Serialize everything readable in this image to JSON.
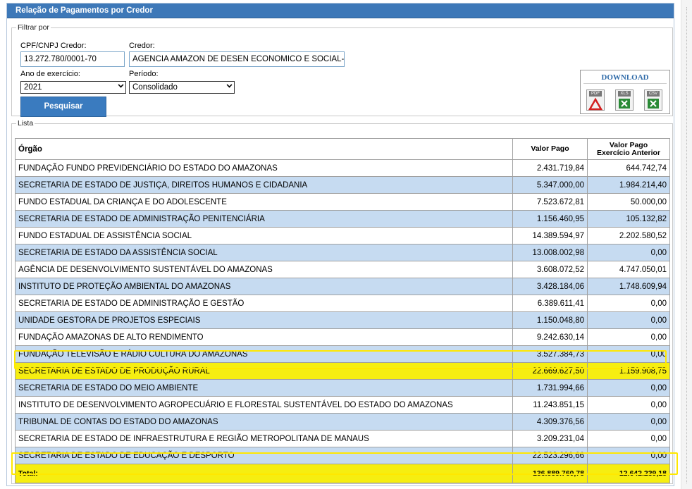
{
  "header": {
    "title": "Relação de Pagamentos por Credor"
  },
  "filter": {
    "legend": "Filtrar por",
    "cpf_label": "CPF/CNPJ Credor:",
    "cpf_value": "13.272.780/0001-70",
    "credor_label": "Credor:",
    "credor_value": "AGENCIA AMAZON DE DESEN ECONOMICO E SOCIAL- A",
    "ano_label": "Ano de exercício:",
    "ano_value": "2021",
    "periodo_label": "Período:",
    "periodo_value": "Consolidado",
    "search_label": "Pesquisar"
  },
  "download": {
    "title": "DOWNLOAD",
    "items": [
      {
        "label": "PDF",
        "icon": "pdf-icon",
        "color": "#d22020"
      },
      {
        "label": "XLS",
        "icon": "xls-icon",
        "color": "#2a8a36"
      },
      {
        "label": "CSV",
        "icon": "csv-icon",
        "color": "#2a8a36"
      }
    ]
  },
  "lista": {
    "legend": "Lista",
    "columns": {
      "orgao": "Órgão",
      "valor_pago": "Valor Pago",
      "valor_anterior_1": "Valor Pago",
      "valor_anterior_2": "Exercício Anterior"
    },
    "rows": [
      {
        "orgao": "FUNDAÇÃO FUNDO PREVIDENCIÁRIO DO ESTADO DO AMAZONAS",
        "valor_pago": "2.431.719,84",
        "valor_anterior": "644.742,74"
      },
      {
        "orgao": "SECRETARIA DE ESTADO DE JUSTIÇA, DIREITOS HUMANOS E CIDADANIA",
        "valor_pago": "5.347.000,00",
        "valor_anterior": "1.984.214,40"
      },
      {
        "orgao": "FUNDO ESTADUAL DA CRIANÇA E DO ADOLESCENTE",
        "valor_pago": "7.523.672,81",
        "valor_anterior": "50.000,00"
      },
      {
        "orgao": "SECRETARIA DE ESTADO DE ADMINISTRAÇÃO PENITENCIÁRIA",
        "valor_pago": "1.156.460,95",
        "valor_anterior": "105.132,82"
      },
      {
        "orgao": "FUNDO ESTADUAL DE ASSISTÊNCIA SOCIAL",
        "valor_pago": "14.389.594,97",
        "valor_anterior": "2.202.580,52"
      },
      {
        "orgao": "SECRETARIA DE ESTADO DA ASSISTÊNCIA SOCIAL",
        "valor_pago": "13.008.002,98",
        "valor_anterior": "0,00"
      },
      {
        "orgao": "AGÊNCIA DE DESENVOLVIMENTO SUSTENTÁVEL DO AMAZONAS",
        "valor_pago": "3.608.072,52",
        "valor_anterior": "4.747.050,01"
      },
      {
        "orgao": "INSTITUTO DE PROTEÇÃO AMBIENTAL DO AMAZONAS",
        "valor_pago": "3.428.184,06",
        "valor_anterior": "1.748.609,94"
      },
      {
        "orgao": "SECRETARIA DE ESTADO DE ADMINISTRAÇÃO E GESTÃO",
        "valor_pago": "6.389.611,41",
        "valor_anterior": "0,00"
      },
      {
        "orgao": "UNIDADE GESTORA DE PROJETOS ESPECIAIS",
        "valor_pago": "1.150.048,80",
        "valor_anterior": "0,00"
      },
      {
        "orgao": "FUNDAÇÃO AMAZONAS DE ALTO RENDIMENTO",
        "valor_pago": "9.242.630,14",
        "valor_anterior": "0,00"
      },
      {
        "orgao": "FUNDAÇÃO TELEVISÃO E RÁDIO CULTURA DO AMAZONAS",
        "valor_pago": "3.527.384,73",
        "valor_anterior": "0,00"
      },
      {
        "orgao": "SECRETARIA DE ESTADO DE PRODUÇÃO RURAL",
        "valor_pago": "22.669.627,50",
        "valor_anterior": "1.159.908,75"
      },
      {
        "orgao": "SECRETARIA DE ESTADO DO MEIO AMBIENTE",
        "valor_pago": "1.731.994,66",
        "valor_anterior": "0,00"
      },
      {
        "orgao": "INSTITUTO DE DESENVOLVIMENTO AGROPECUÁRIO E FLORESTAL SUSTENTÁVEL DO ESTADO DO AMAZONAS",
        "valor_pago": "11.243.851,15",
        "valor_anterior": "0,00"
      },
      {
        "orgao": "TRIBUNAL DE CONTAS DO ESTADO DO AMAZONAS",
        "valor_pago": "4.309.376,56",
        "valor_anterior": "0,00"
      },
      {
        "orgao": "SECRETARIA DE ESTADO DE INFRAESTRUTURA E REGIÃO METROPOLITANA DE MANAUS",
        "valor_pago": "3.209.231,04",
        "valor_anterior": "0,00"
      },
      {
        "orgao": "SECRETARIA DE ESTADO DE EDUCAÇÃO E DESPORTO",
        "valor_pago": "22.523.296,66",
        "valor_anterior": "0,00"
      }
    ],
    "total": {
      "label": "Total:",
      "valor_pago": "136.889.760,78",
      "valor_anterior": "12.642.239,18"
    },
    "highlight_color": "#f6ee11",
    "alt_row_color": "#c6dbf1"
  }
}
